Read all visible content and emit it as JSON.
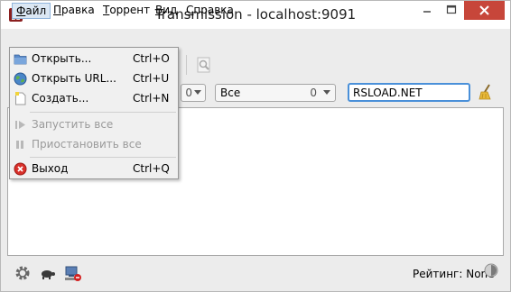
{
  "window": {
    "title": "Transmission - localhost:9091"
  },
  "menubar": {
    "items": [
      {
        "label": "Файл",
        "accel_underline": "Ф",
        "rest": "айл"
      },
      {
        "label": "Правка",
        "accel_underline": "П",
        "rest": "равка"
      },
      {
        "label": "Торрент",
        "accel_underline": "Т",
        "rest": "оррент"
      },
      {
        "label": "Вид",
        "accel_underline": "В",
        "rest": "ид"
      },
      {
        "label": "Справка",
        "accel_underline": "С",
        "rest": "правка"
      }
    ]
  },
  "file_menu": {
    "open": {
      "label": "Открыть...",
      "shortcut": "Ctrl+O",
      "icon": "folder-icon"
    },
    "open_url": {
      "label": "Открыть URL...",
      "shortcut": "Ctrl+U",
      "icon": "globe-icon"
    },
    "create": {
      "label": "Создать...",
      "shortcut": "Ctrl+N",
      "icon": "new-document-icon"
    },
    "start_all": {
      "label": "Запустить все",
      "icon": "play-icon",
      "disabled": true
    },
    "pause_all": {
      "label": "Приостановить все",
      "icon": "pause-icon",
      "disabled": true
    },
    "quit": {
      "label": "Выход",
      "shortcut": "Ctrl+Q",
      "icon": "quit-icon"
    }
  },
  "filterbar": {
    "left_combo_count": "0",
    "status_filter": {
      "value": "Все",
      "count": "0"
    },
    "search_text": "RSLOAD.NET"
  },
  "statusbar": {
    "ratio_label": "Рейтинг: None"
  },
  "colors": {
    "close_button": "#c7463a",
    "search_border": "#4a90d9",
    "menu_active_bg": "#dbe7f4"
  }
}
